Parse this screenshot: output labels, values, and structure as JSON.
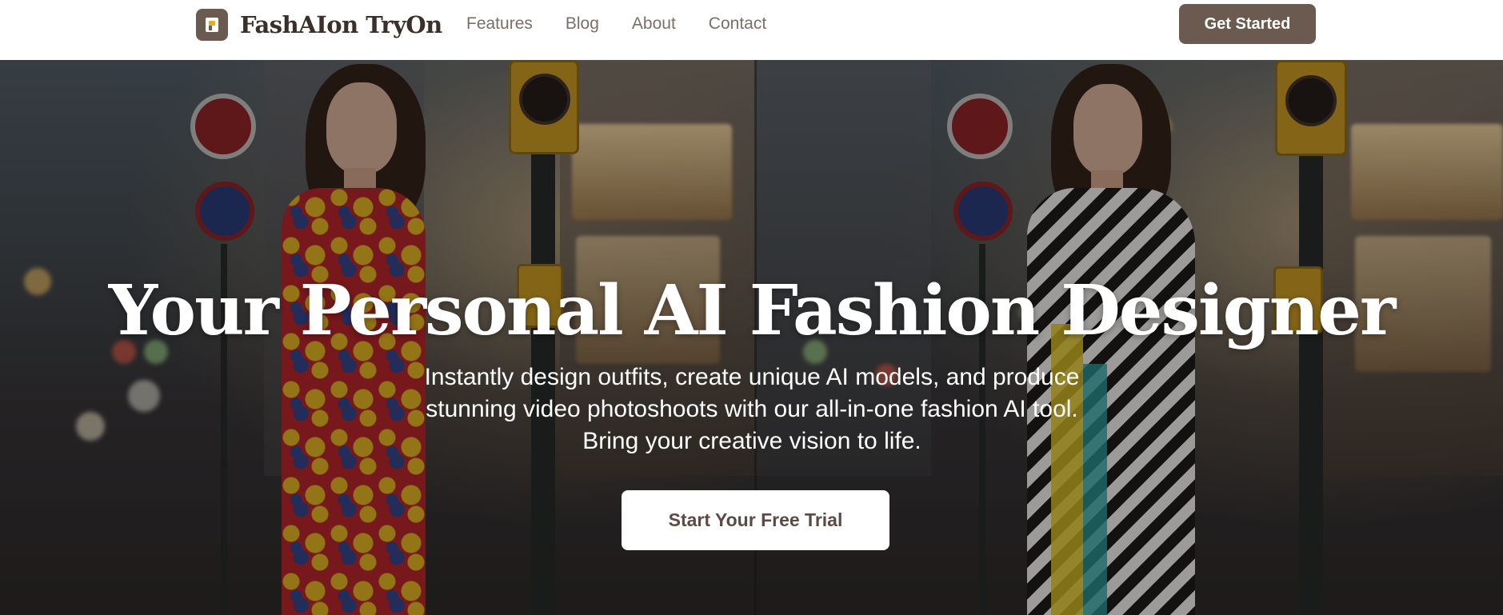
{
  "brand": {
    "name": "FashAIon TryOn",
    "logo_icon": "brand-logo-icon",
    "accent_color": "#6b5a4f"
  },
  "nav": {
    "links": [
      {
        "label": "Features"
      },
      {
        "label": "Blog"
      },
      {
        "label": "About"
      },
      {
        "label": "Contact"
      }
    ],
    "cta_label": "Get Started"
  },
  "hero": {
    "title": "Your Personal AI Fashion Designer",
    "subtitle_lines": [
      "Instantly design outfits, create unique AI models, and produce",
      "stunning video photoshoots with our all-in-one fashion AI tool.",
      "Bring your creative vision to life."
    ],
    "cta_label": "Start Your Free Trial"
  }
}
